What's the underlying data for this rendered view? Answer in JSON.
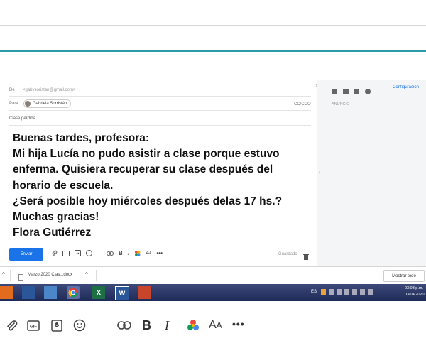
{
  "compose": {
    "from_label": "De",
    "from_value": "<gabysoristan@gmail.com>",
    "to_label": "Para",
    "to_chip": "Gabriela Sorristán",
    "cc_bcc": "CC/CCO",
    "subject": "Clase perdida",
    "body_lines": [
      "Buenas tardes, profesora:",
      "Mi hija Lucía no pudo asistir a clase porque estuvo",
      "enferma. Quisiera recuperar su clase después del",
      "horario de escuela.",
      "¿Será posible hoy miércoles después delas 17 hs.?",
      "Muchas gracias!",
      "Flora Gutiérrez"
    ],
    "send_label": "Enviar",
    "saved_label": "Guardado"
  },
  "right_panel": {
    "settings_label": "Configuración",
    "ad_label": "ANUNCIO"
  },
  "attachment_bar": {
    "file_name": "Marzo 2020 Clas...docx",
    "show_all": "Mostrar todo"
  },
  "taskbar": {
    "lang": "ES",
    "time": "03:03 p.m.",
    "date": "03/04/2020"
  },
  "icons": [
    "attach-icon",
    "gif-icon",
    "sticker-icon",
    "emoji-icon",
    "link-icon",
    "bold-icon",
    "italic-icon",
    "color-icon",
    "font-size-icon",
    "more-icon",
    "trash-icon"
  ],
  "colors": {
    "accent": "#1a73e8",
    "teal_line": "#2a9aa6",
    "taskbar": "#2a3668"
  }
}
